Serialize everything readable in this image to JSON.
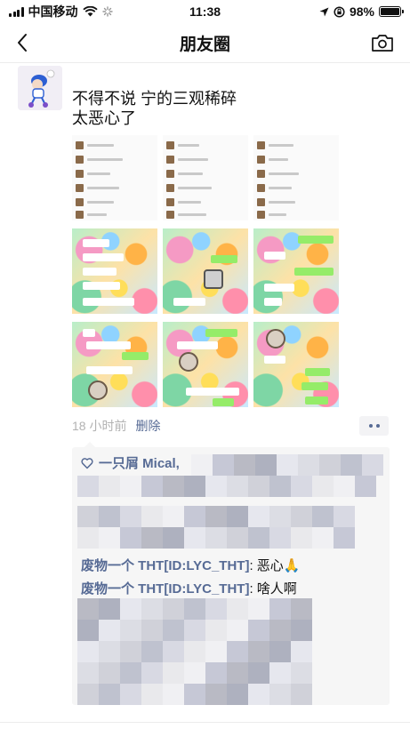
{
  "status_bar": {
    "carrier": "中国移动",
    "time": "11:38",
    "battery_percent": "98%",
    "battery_level": 0.98,
    "icons": [
      "signal-icon",
      "wifi-icon",
      "loading-icon",
      "location-icon",
      "rotation-lock-icon",
      "battery-icon"
    ]
  },
  "nav": {
    "title": "朋友圈",
    "back_icon": "chevron-left-icon",
    "camera_icon": "camera-icon"
  },
  "post": {
    "text_line1": "不得不说 宁的三观稀碎",
    "text_line2": "太恶心了",
    "image_count": 9,
    "time_ago": "18 小时前",
    "delete_label": "删除"
  },
  "comments_section": {
    "likes_text": "一只屑 Mical,",
    "comments": [
      {
        "author": "废物一个 THT[ID:LYC_THT]",
        "separator": ": ",
        "text": "恶心🙏"
      },
      {
        "author": "废物一个 THT[ID:LYC_THT]",
        "separator": ": ",
        "text": "啥人啊"
      }
    ]
  },
  "colors": {
    "link_blue": "#576b95",
    "comment_bg": "#f6f6f6",
    "meta_gray": "#b2b2b2",
    "wechat_green": "#95ec69"
  }
}
